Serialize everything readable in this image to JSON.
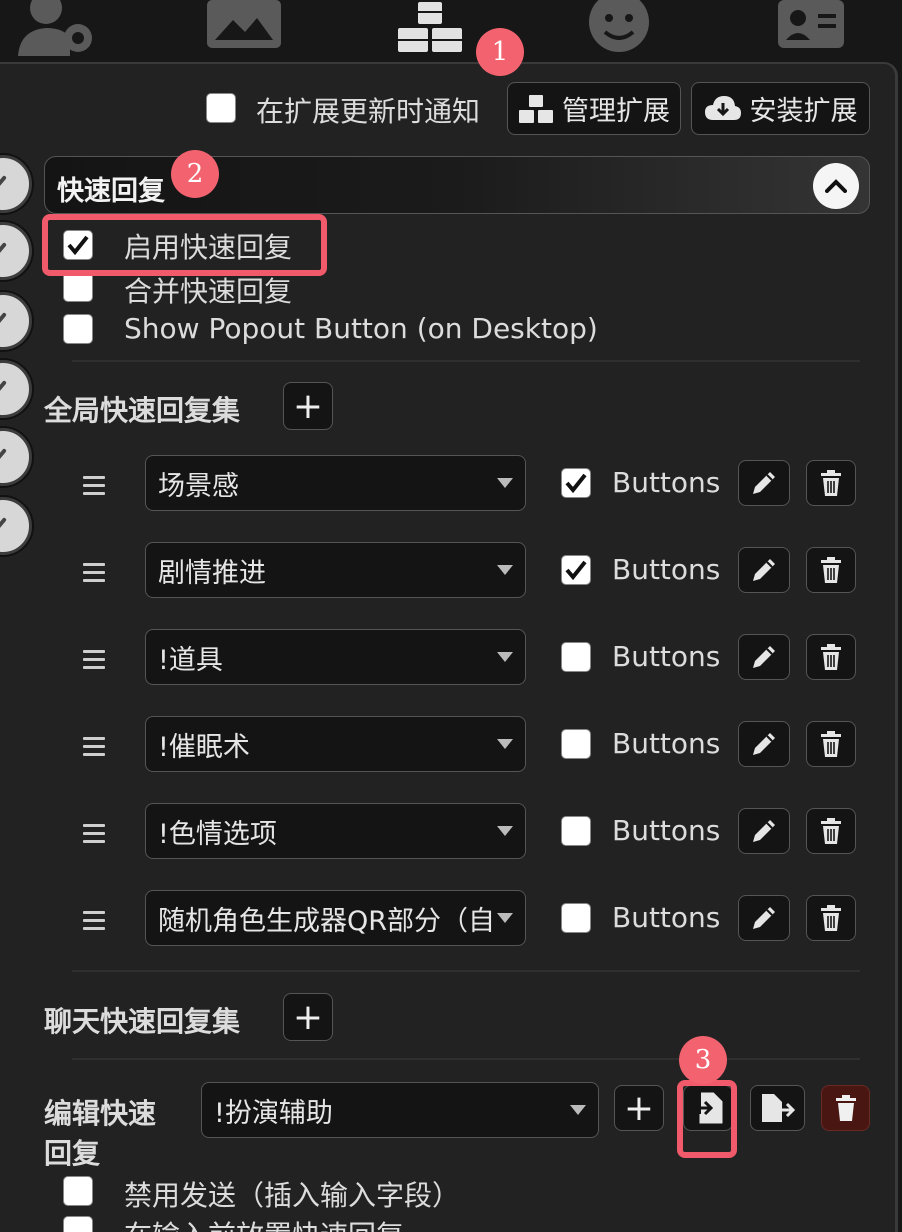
{
  "top_nav": {
    "icons": [
      "user-settings-icon",
      "image-icon",
      "extensions-icon",
      "smiley-icon",
      "contact-card-icon"
    ]
  },
  "extensions_bar": {
    "notify_label": "在扩展更新时通知",
    "notify_checked": false,
    "manage_label": "管理扩展",
    "install_label": "安装扩展"
  },
  "drawer": {
    "title": "快速回复",
    "expanded": true
  },
  "options": [
    {
      "label": "启用快速回复",
      "checked": true
    },
    {
      "label": "合并快速回复",
      "checked": false
    },
    {
      "label": "Show Popout Button (on Desktop)",
      "checked": false
    }
  ],
  "global_sets": {
    "title": "全局快速回复集",
    "add_label": "+",
    "rows": [
      {
        "name": "场景感",
        "buttons_checked": true,
        "buttons_label": "Buttons"
      },
      {
        "name": "剧情推进",
        "buttons_checked": true,
        "buttons_label": "Buttons"
      },
      {
        "name": "!道具",
        "buttons_checked": false,
        "buttons_label": "Buttons"
      },
      {
        "name": "!催眠术",
        "buttons_checked": false,
        "buttons_label": "Buttons"
      },
      {
        "name": "!色情选项",
        "buttons_checked": false,
        "buttons_label": "Buttons"
      },
      {
        "name": "随机角色生成器QR部分（自",
        "buttons_checked": false,
        "buttons_label": "Buttons"
      }
    ]
  },
  "chat_sets": {
    "title": "聊天快速回复集",
    "add_label": "+"
  },
  "edit": {
    "label_line1": "编辑快速",
    "label_line2": "回复",
    "selected_set": "!扮演辅助",
    "add_label": "+"
  },
  "edit_options": [
    {
      "label": "禁用发送（插入输入字段）",
      "checked": false
    },
    {
      "label": "在输入前放置快速回复",
      "checked": false
    }
  ],
  "annotations": [
    "1",
    "2",
    "3"
  ],
  "colors": {
    "annotation": "#f2636f",
    "background": "#222222",
    "delete_button": "#4a1612"
  }
}
